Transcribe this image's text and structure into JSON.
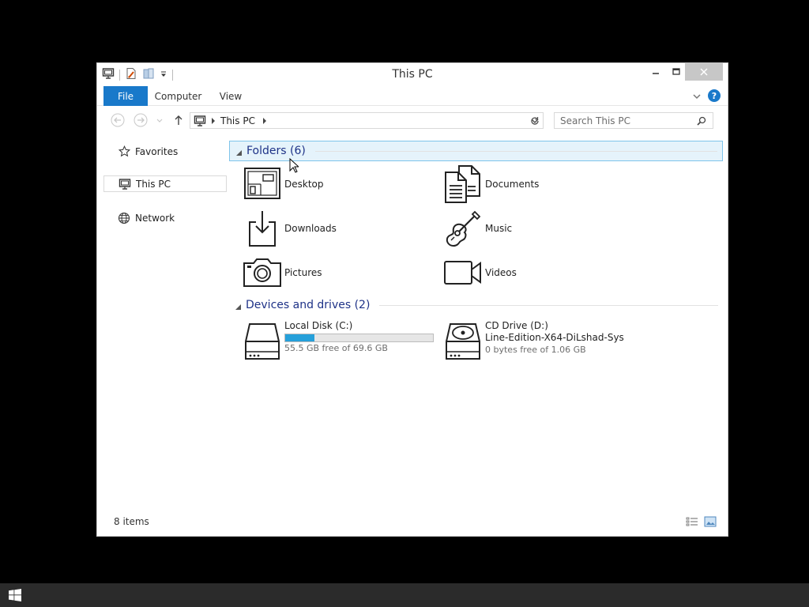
{
  "window": {
    "title": "This PC"
  },
  "ribbon": {
    "tabs": [
      {
        "label": "File",
        "active": true
      },
      {
        "label": "Computer"
      },
      {
        "label": "View"
      }
    ],
    "help_label": "?"
  },
  "address": {
    "location": "This PC",
    "search_placeholder": "Search This PC"
  },
  "sidebar": {
    "items": [
      {
        "label": "Favorites",
        "icon": "star-icon"
      },
      {
        "label": "This PC",
        "icon": "computer-icon",
        "selected": true
      },
      {
        "label": "Network",
        "icon": "network-icon"
      }
    ]
  },
  "groups": {
    "folders": {
      "title": "Folders (6)",
      "items": [
        {
          "label": "Desktop",
          "icon": "desktop-folder-icon"
        },
        {
          "label": "Documents",
          "icon": "documents-folder-icon"
        },
        {
          "label": "Downloads",
          "icon": "downloads-folder-icon"
        },
        {
          "label": "Music",
          "icon": "music-folder-icon"
        },
        {
          "label": "Pictures",
          "icon": "pictures-folder-icon"
        },
        {
          "label": "Videos",
          "icon": "videos-folder-icon"
        }
      ]
    },
    "drives": {
      "title": "Devices and drives (2)",
      "items": [
        {
          "name": "Local Disk (C:)",
          "free": "55.5 GB free of 69.6 GB",
          "used_fraction": 0.2,
          "icon": "hard-disk-icon"
        },
        {
          "name": "CD Drive (D:)",
          "volume_label": "Line-Edition-X64-DiLshad-Sys",
          "free": "0 bytes free of 1.06 GB",
          "icon": "cd-drive-icon"
        }
      ]
    }
  },
  "status": {
    "items_count": "8 items"
  },
  "colors": {
    "accent": "#1979ca",
    "group_title": "#1e3287",
    "selection_bg": "#e5f3fb",
    "selection_border": "#7fc4ea",
    "usage_bar": "#26a0da",
    "taskbar": "#2b2b2b"
  }
}
